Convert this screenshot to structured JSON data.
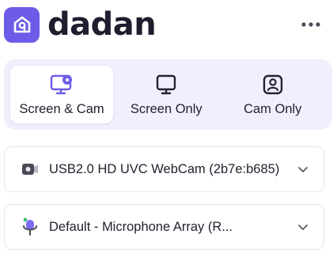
{
  "app": {
    "brand": "dadan"
  },
  "colors": {
    "accent": "#6c5ce7",
    "panel": "#f1effd",
    "text": "#1f1f2e"
  },
  "header": {
    "more_icon": "more-horizontal-icon"
  },
  "modes": [
    {
      "label": "Screen & Cam",
      "icon": "screen-cam-icon",
      "active": true
    },
    {
      "label": "Screen Only",
      "icon": "monitor-icon",
      "active": false
    },
    {
      "label": "Cam Only",
      "icon": "user-portrait-icon",
      "active": false
    }
  ],
  "camera": {
    "selected": "USB2.0 HD UVC WebCam (2b7e:b685)",
    "icon": "webcam-icon"
  },
  "microphone": {
    "selected": "Default - Microphone Array (R...",
    "icon": "microphone-icon"
  }
}
